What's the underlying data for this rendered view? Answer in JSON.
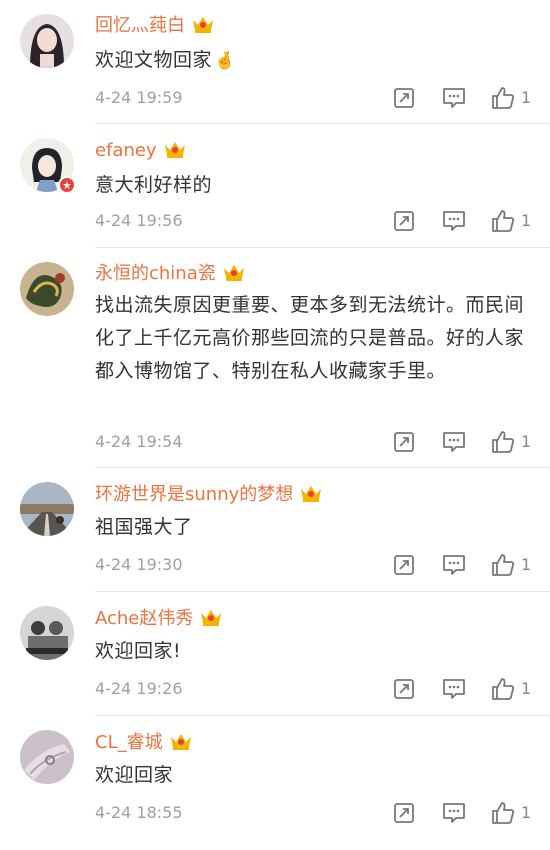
{
  "comments": [
    {
      "username": "回忆灬莼白",
      "content": "欢迎文物回家",
      "emoji": "🤞",
      "time": "4-24 19:59",
      "likes": "1",
      "avatar_colors": [
        "#eae2e9",
        "#2a2329"
      ]
    },
    {
      "username": "efaney",
      "content": "意大利好样的",
      "time": "4-24 19:56",
      "likes": "1",
      "avatar_colors": [
        "#f1ede6",
        "#20242a"
      ]
    },
    {
      "username": "永恒的china瓷",
      "content": "找出流失原因更重要、更本多到无法统计。而民间化了上千亿元高价那些回流的只是普品。好的人家都入博物馆了、特别在私人收藏家手里。",
      "time": "4-24 19:54",
      "likes": "1",
      "avatar_colors": [
        "#b8a07a",
        "#35412a"
      ]
    },
    {
      "username": "环游世界是sunny的梦想",
      "content": "祖国强大了",
      "time": "4-24 19:30",
      "likes": "1",
      "avatar_colors": [
        "#9aa9b8",
        "#6b5a48"
      ]
    },
    {
      "username": "Ache赵伟秀",
      "content": "欢迎回家!",
      "time": "4-24 19:26",
      "likes": "1",
      "avatar_colors": [
        "#d7d7d7",
        "#4a4a4a"
      ]
    },
    {
      "username": "CL_睿城",
      "content": "欢迎回家",
      "time": "4-24 18:55",
      "likes": "1",
      "avatar_colors": [
        "#c9bcc7",
        "#8c8190"
      ]
    }
  ],
  "icons": {
    "repost": "repost-icon",
    "comment": "comment-icon",
    "like": "thumbs-up-icon",
    "vip": "vip-crown-icon"
  },
  "colors": {
    "username": "#eb7340",
    "text": "#333333",
    "meta": "#a0a0a0",
    "divider": "#e6e6e6",
    "vip_gold": "#f5b400"
  }
}
